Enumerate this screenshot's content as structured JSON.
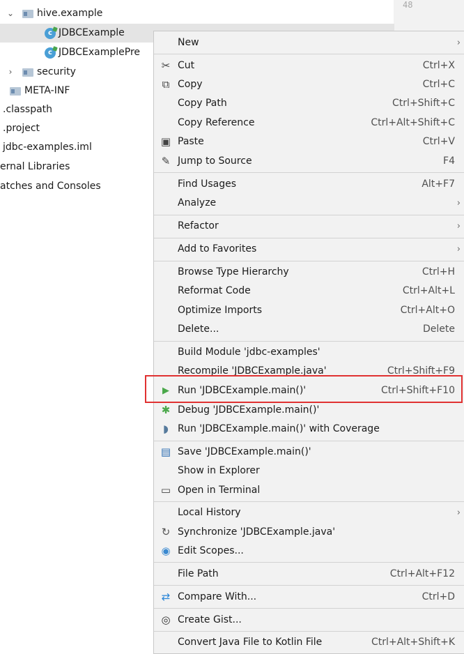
{
  "tree": {
    "rows": [
      {
        "chevron": "⌄",
        "icon": "folder-icon",
        "label": "hive.example"
      },
      {
        "icon": "class-icon",
        "label": "JDBCExample"
      },
      {
        "icon": "class-icon",
        "label": "JDBCExamplePre"
      },
      {
        "chevron": "›",
        "icon": "folder-icon",
        "label": "security"
      },
      {
        "icon": "folder-icon",
        "label": "META-INF"
      },
      {
        "label": ".classpath"
      },
      {
        "label": ".project"
      },
      {
        "label": "jdbc-examples.iml"
      },
      {
        "label": "ernal Libraries"
      },
      {
        "label": "atches and Consoles"
      }
    ],
    "class_icon_letter": "c",
    "gutter_number": "48"
  },
  "menu": {
    "items": [
      {
        "label": "New",
        "submenu": true
      },
      {
        "label": "Cut",
        "shortcut": "Ctrl+X",
        "icon": "scissors-icon"
      },
      {
        "label": "Copy",
        "shortcut": "Ctrl+C",
        "icon": "copy-icon"
      },
      {
        "label": "Copy Path",
        "shortcut": "Ctrl+Shift+C"
      },
      {
        "label": "Copy Reference",
        "shortcut": "Ctrl+Alt+Shift+C"
      },
      {
        "label": "Paste",
        "shortcut": "Ctrl+V",
        "icon": "paste-icon"
      },
      {
        "label": "Jump to Source",
        "shortcut": "F4",
        "icon": "jump-icon"
      },
      {
        "label": "Find Usages",
        "shortcut": "Alt+F7"
      },
      {
        "label": "Analyze",
        "submenu": true
      },
      {
        "label": "Refactor",
        "submenu": true
      },
      {
        "label": "Add to Favorites",
        "submenu": true
      },
      {
        "label": "Browse Type Hierarchy",
        "shortcut": "Ctrl+H"
      },
      {
        "label": "Reformat Code",
        "shortcut": "Ctrl+Alt+L"
      },
      {
        "label": "Optimize Imports",
        "shortcut": "Ctrl+Alt+O"
      },
      {
        "label": "Delete...",
        "shortcut": "Delete"
      },
      {
        "label": "Build Module 'jdbc-examples'"
      },
      {
        "label": "Recompile 'JDBCExample.java'",
        "shortcut": "Ctrl+Shift+F9"
      },
      {
        "label": "Run 'JDBCExample.main()'",
        "shortcut": "Ctrl+Shift+F10",
        "icon": "run-icon"
      },
      {
        "label": "Debug 'JDBCExample.main()'",
        "icon": "debug-icon"
      },
      {
        "label": "Run 'JDBCExample.main()' with Coverage",
        "icon": "coverage-icon"
      },
      {
        "label": "Save 'JDBCExample.main()'",
        "icon": "save-config-icon"
      },
      {
        "label": "Show in Explorer"
      },
      {
        "label": "Open in Terminal",
        "icon": "terminal-icon"
      },
      {
        "label": "Local History",
        "submenu": true
      },
      {
        "label": "Synchronize 'JDBCExample.java'",
        "icon": "sync-icon"
      },
      {
        "label": "Edit Scopes...",
        "icon": "scope-icon"
      },
      {
        "label": "File Path",
        "shortcut": "Ctrl+Alt+F12"
      },
      {
        "label": "Compare With...",
        "shortcut": "Ctrl+D",
        "icon": "compare-icon"
      },
      {
        "label": "Create Gist...",
        "icon": "gist-icon"
      },
      {
        "label": "Convert Java File to Kotlin File",
        "shortcut": "Ctrl+Alt+Shift+K"
      }
    ],
    "glyphs": {
      "scissors": "✂",
      "copy": "⧉",
      "paste": "▣",
      "jump": "✎",
      "run": "▶",
      "debug": "✱",
      "coverage": "◗",
      "save": "▤",
      "terminal": "▭",
      "sync": "↻",
      "scope": "◉",
      "compare": "⇄",
      "gist": "◎",
      "submenu_arrow": "›"
    }
  },
  "colors": {
    "highlight_border": "#e03131",
    "menu_background": "#f2f2f2",
    "run_green": "#4aa84a"
  }
}
